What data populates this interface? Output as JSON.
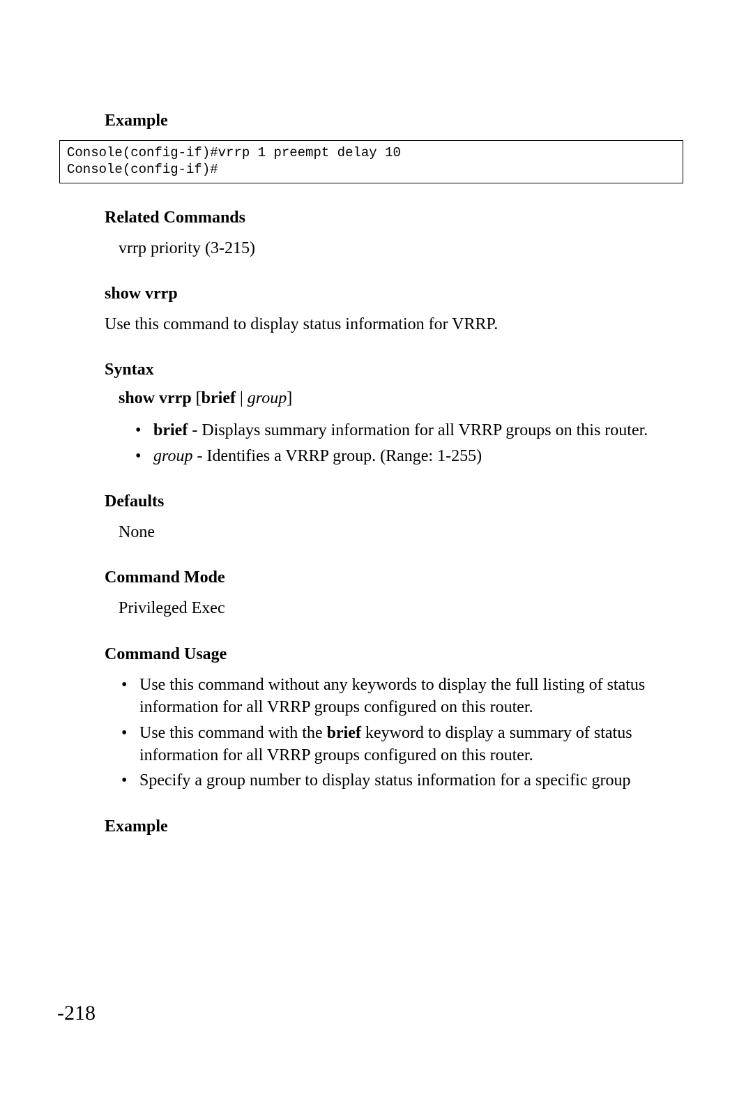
{
  "sections": {
    "example1_heading": "Example",
    "code_block": "Console(config-if)#vrrp 1 preempt delay 10\nConsole(config-if)#",
    "related_commands_heading": "Related Commands",
    "related_commands_text": "vrrp priority (3-215)",
    "show_vrrp_heading": "show vrrp",
    "show_vrrp_desc": "Use this command to display status information for VRRP.",
    "syntax_heading": "Syntax",
    "syntax_cmd_bold": "show vrrp",
    "syntax_bracket_open": " [",
    "syntax_brief_bold": "brief",
    "syntax_pipe": " | ",
    "syntax_group_italic": "group",
    "syntax_bracket_close": "]",
    "syntax_bullet1_term": "brief",
    "syntax_bullet1_sep": " - ",
    "syntax_bullet1_desc": "Displays summary information for all VRRP groups on this router.",
    "syntax_bullet2_term": "group",
    "syntax_bullet2_sep": " - ",
    "syntax_bullet2_desc": "Identifies a VRRP group. (Range: 1-255)",
    "defaults_heading": "Defaults",
    "defaults_text": "None",
    "command_mode_heading": "Command Mode",
    "command_mode_text": "Privileged Exec",
    "command_usage_heading": "Command Usage",
    "usage_bullet1": "Use this command without any keywords to display the full listing of status information for all VRRP groups configured on this router.",
    "usage_bullet2_pre": "Use this command with the ",
    "usage_bullet2_bold": "brief",
    "usage_bullet2_post": " keyword to display a summary of status information for all VRRP groups configured on this router.",
    "usage_bullet3": "Specify a group number to display status information for a specific group",
    "example2_heading": "Example"
  },
  "page_number": "-218"
}
